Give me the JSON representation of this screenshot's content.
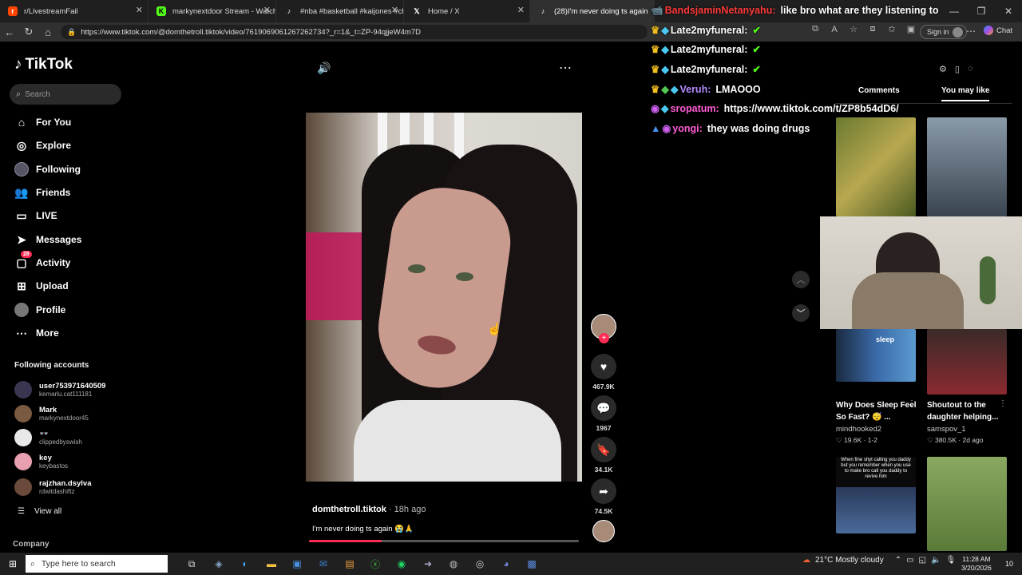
{
  "browser": {
    "tabs": [
      {
        "label": "r/LivestreamFail",
        "icon_name": "reddit-icon"
      },
      {
        "label": "markynextdoor Stream - Watch Li",
        "icon_name": "kick-icon"
      },
      {
        "label": "#nba #basketball #kaijones #char",
        "icon_name": "tiktok-icon"
      },
      {
        "label": "Home / X",
        "icon_name": "x-icon"
      },
      {
        "label": "(28)I'm never doing ts again",
        "icon_name": "tiktok-icon"
      }
    ],
    "url": "https://www.tiktok.com/@domthetroll.tiktok/video/7619069061267262734?_r=1&_t=ZP-94qjjeW4m7D",
    "signin_label": "Sign in",
    "chat_label": "Chat"
  },
  "sidebar": {
    "brand": "TikTok",
    "search_placeholder": "Search",
    "nav": [
      {
        "label": "For You",
        "icon_name": "home-icon"
      },
      {
        "label": "Explore",
        "icon_name": "compass-icon"
      },
      {
        "label": "Following",
        "icon_name": "following-avatar-icon"
      },
      {
        "label": "Friends",
        "icon_name": "friends-icon"
      },
      {
        "label": "LIVE",
        "icon_name": "live-icon"
      },
      {
        "label": "Messages",
        "icon_name": "messages-icon"
      },
      {
        "label": "Activity",
        "icon_name": "activity-icon",
        "badge": "28"
      },
      {
        "label": "Upload",
        "icon_name": "upload-icon"
      },
      {
        "label": "Profile",
        "icon_name": "profile-avatar-icon"
      },
      {
        "label": "More",
        "icon_name": "more-icon"
      }
    ],
    "following_heading": "Following accounts",
    "following": [
      {
        "name": "user753971640509",
        "handle": "kemarlu.cat111181"
      },
      {
        "name": "Mark",
        "handle": "markynextdoor45"
      },
      {
        "name": "👓",
        "handle": "clippedbyswish"
      },
      {
        "name": "key",
        "handle": "keybastos"
      },
      {
        "name": "rajzhan.dsylva",
        "handle": "rdwitdashiftz"
      }
    ],
    "view_all": "View all",
    "company": "Company"
  },
  "video": {
    "author": "domthetroll.tiktok",
    "time": "· 18h ago",
    "caption": "I'm never doing ts again 😭🙏",
    "progress": 0.27,
    "actions": {
      "likes": "467.9K",
      "comments": "1967",
      "saves": "34.1K",
      "shares": "74.5K"
    }
  },
  "chat": [
    {
      "user": "BandsjaminNetanyahu:",
      "message": "like bro what are they listening to",
      "user_color": "#ff3b3b"
    },
    {
      "user": "Late2myfuneral:",
      "message": "✔",
      "user_color": "#ffffff"
    },
    {
      "user": "Late2myfuneral:",
      "message": "✔",
      "user_color": "#ffffff"
    },
    {
      "user": "Late2myfuneral:",
      "message": "✔",
      "user_color": "#ffffff"
    },
    {
      "user": "Veruh:",
      "message": "LMAOOO",
      "user_color": "#b48cff"
    },
    {
      "user": "sropatum:",
      "message": "https://www.tiktok.com/t/ZP8b54dD6/",
      "user_color": "#ff5cd6"
    },
    {
      "user": "yongi:",
      "message": "they was doing drugs",
      "user_color": "#ff5cd6"
    }
  ],
  "right_panel": {
    "tabs": [
      "Comments",
      "You may like"
    ],
    "videos": [
      {
        "title": "Why Does Sleep Feel So Fast? 😴 ...",
        "author": "mindhooked2",
        "stats": "♡ 19.6K · 1-2"
      },
      {
        "title": "Shoutout to the daughter helping...",
        "author": "samspov_1",
        "stats": "♡ 380.5K · 2d ago"
      }
    ],
    "thumb_texts": [
      "sleep",
      "When fine shyt calling you daddy but you remember when you use to make bro call you daddy to revive him"
    ]
  },
  "taskbar": {
    "search_placeholder": "Type here to search",
    "weather": "21°C  Mostly cloudy",
    "time": "11:28 AM",
    "date": "3/20/2026",
    "notif_count": "10"
  }
}
